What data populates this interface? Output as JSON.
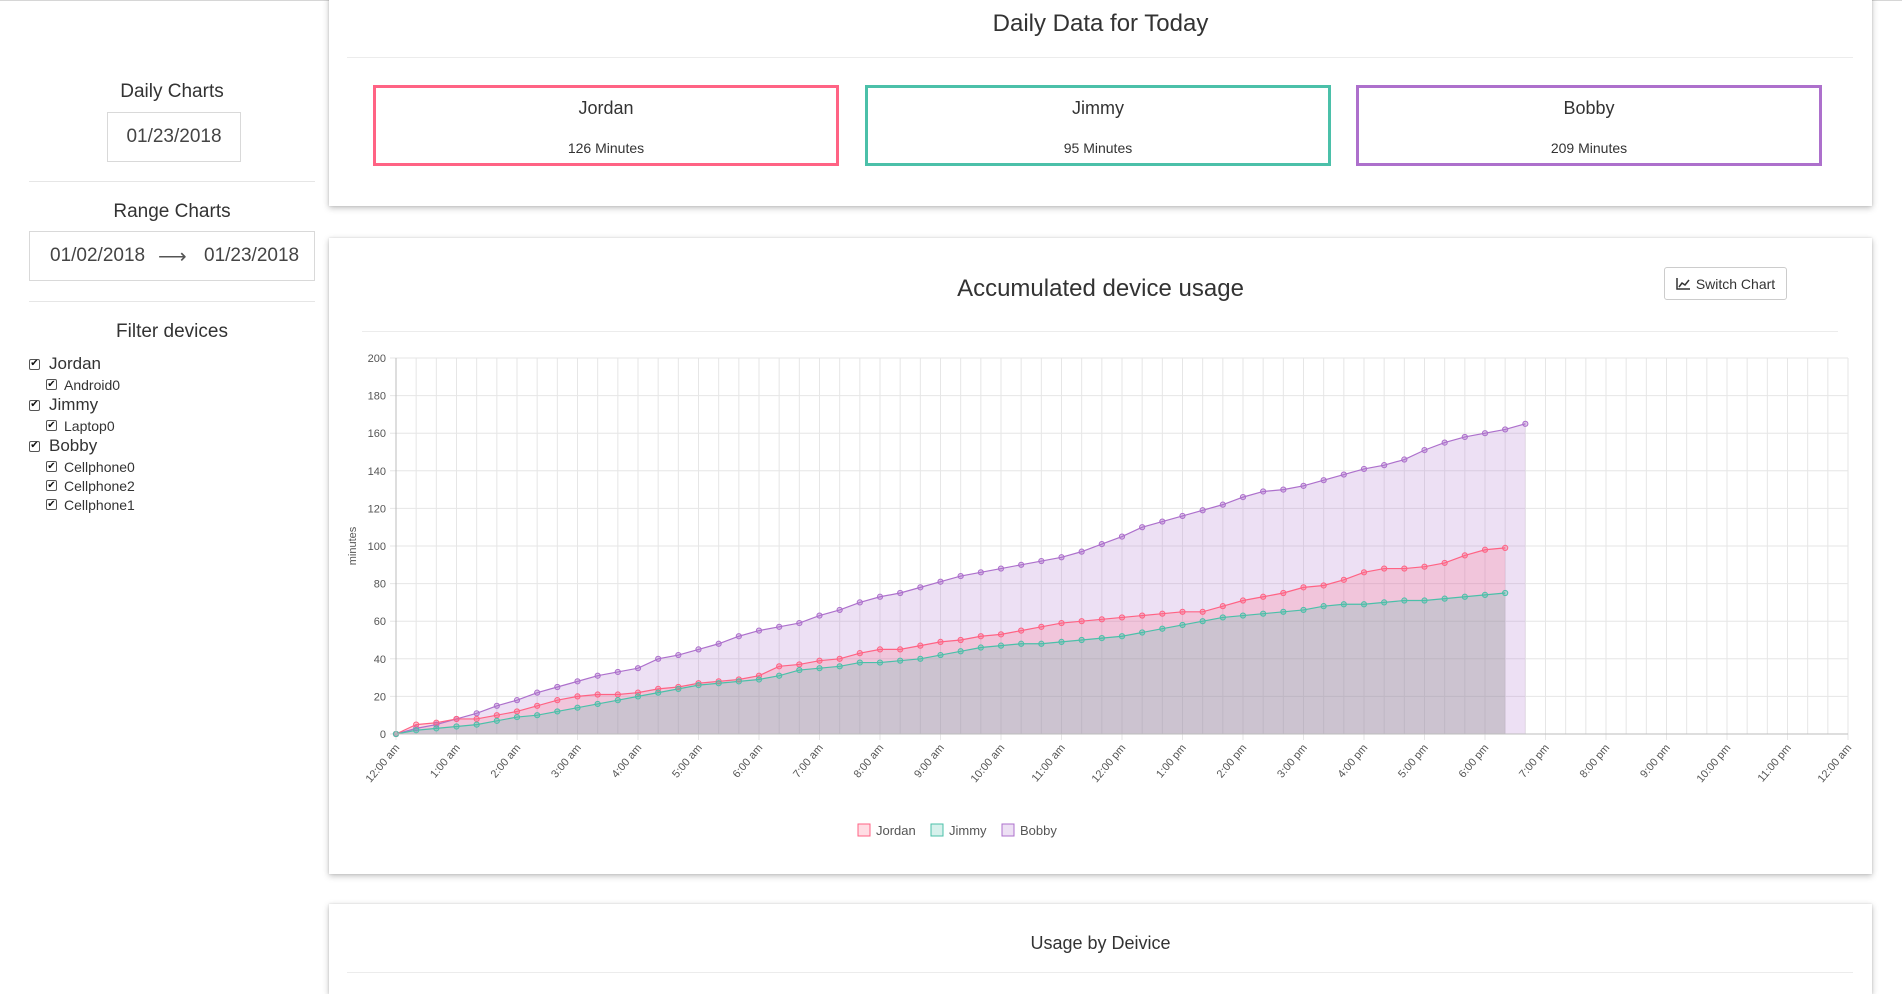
{
  "sidebar": {
    "daily_title": "Daily Charts",
    "daily_date": "01/23/2018",
    "range_title": "Range Charts",
    "range_from": "01/02/2018",
    "range_arrow": "⟶",
    "range_to": "01/23/2018",
    "filter_title": "Filter devices",
    "filters": [
      {
        "label": "Jordan",
        "checked": true,
        "devices": [
          {
            "label": "Android0",
            "checked": true
          }
        ]
      },
      {
        "label": "Jimmy",
        "checked": true,
        "devices": [
          {
            "label": "Laptop0",
            "checked": true
          }
        ]
      },
      {
        "label": "Bobby",
        "checked": true,
        "devices": [
          {
            "label": "Cellphone0",
            "checked": true
          },
          {
            "label": "Cellphone2",
            "checked": true
          },
          {
            "label": "Cellphone1",
            "checked": true
          }
        ]
      }
    ]
  },
  "daily": {
    "title": "Daily Data for Today",
    "people": [
      {
        "name": "Jordan",
        "minutes": "126 Minutes",
        "color": "#ff6384"
      },
      {
        "name": "Jimmy",
        "minutes": "95 Minutes",
        "color": "#4bc0a9"
      },
      {
        "name": "Bobby",
        "minutes": "209 Minutes",
        "color": "#ad70cc"
      }
    ]
  },
  "accumulated": {
    "title": "Accumulated device usage",
    "switch_label": "Switch Chart",
    "switch_icon": "line-chart-icon"
  },
  "usage": {
    "title": "Usage by Deivice"
  },
  "chart_data": {
    "type": "area",
    "title": "Accumulated device usage",
    "xlabel": "",
    "ylabel": "minutes",
    "ylim": [
      0,
      200
    ],
    "yticks": [
      0,
      20,
      40,
      60,
      80,
      100,
      120,
      140,
      160,
      180,
      200
    ],
    "xticks": [
      "12:00 am",
      "1:00 am",
      "2:00 am",
      "3:00 am",
      "4:00 am",
      "5:00 am",
      "6:00 am",
      "7:00 am",
      "8:00 am",
      "9:00 am",
      "10:00 am",
      "11:00 am",
      "12:00 pm",
      "1:00 pm",
      "2:00 pm",
      "3:00 pm",
      "4:00 pm",
      "5:00 pm",
      "6:00 pm",
      "7:00 pm",
      "8:00 pm",
      "9:00 pm",
      "10:00 pm",
      "11:00 pm",
      "12:00 am"
    ],
    "x_unit": "hours since 12:00 am, 20-minute intervals",
    "grid": true,
    "legend_position": "bottom",
    "series": [
      {
        "name": "Jordan",
        "color": "#ff6384",
        "values": [
          0,
          5,
          6,
          8,
          8,
          10,
          12,
          15,
          18,
          20,
          21,
          21,
          22,
          24,
          25,
          27,
          28,
          29,
          31,
          36,
          37,
          39,
          40,
          43,
          45,
          45,
          47,
          49,
          50,
          52,
          53,
          55,
          57,
          59,
          60,
          61,
          62,
          63,
          64,
          65,
          65,
          68,
          71,
          73,
          75,
          78,
          79,
          82,
          86,
          88,
          88,
          89,
          91,
          95,
          98,
          99
        ]
      },
      {
        "name": "Jimmy",
        "color": "#4bc0a9",
        "values": [
          0,
          2,
          3,
          4,
          5,
          7,
          9,
          10,
          12,
          14,
          16,
          18,
          20,
          22,
          24,
          26,
          27,
          28,
          29,
          31,
          34,
          35,
          36,
          38,
          38,
          39,
          40,
          42,
          44,
          46,
          47,
          48,
          48,
          49,
          50,
          51,
          52,
          54,
          56,
          58,
          60,
          62,
          63,
          64,
          65,
          66,
          68,
          69,
          69,
          70,
          71,
          71,
          72,
          73,
          74,
          75
        ]
      },
      {
        "name": "Bobby",
        "color": "#ad70cc",
        "values": [
          0,
          3,
          5,
          8,
          11,
          15,
          18,
          22,
          25,
          28,
          31,
          33,
          35,
          40,
          42,
          45,
          48,
          52,
          55,
          57,
          59,
          63,
          66,
          70,
          73,
          75,
          78,
          81,
          84,
          86,
          88,
          90,
          92,
          94,
          97,
          101,
          105,
          110,
          113,
          116,
          119,
          122,
          126,
          129,
          130,
          132,
          135,
          138,
          141,
          143,
          146,
          151,
          155,
          158,
          160,
          162,
          165
        ]
      }
    ]
  }
}
